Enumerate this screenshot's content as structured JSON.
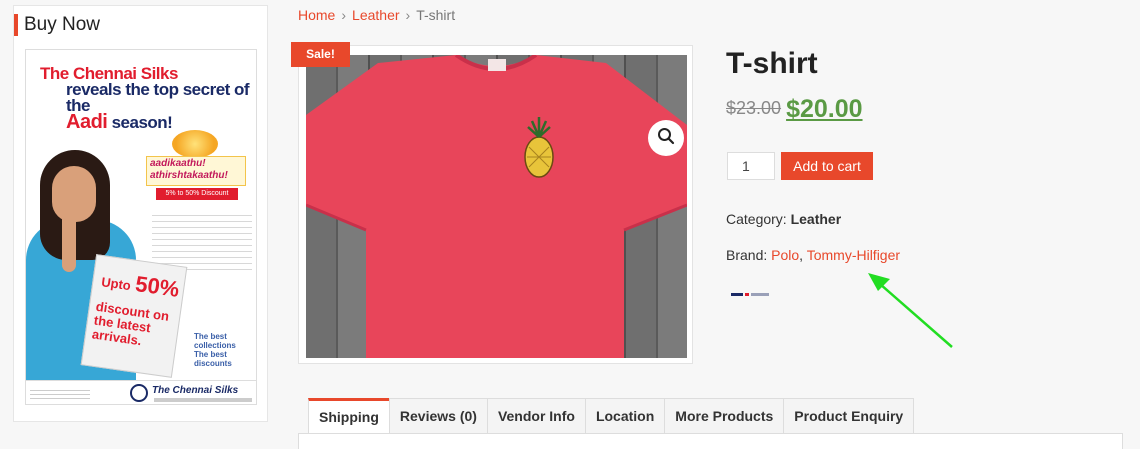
{
  "sidebar": {
    "title": "Buy Now",
    "ad": {
      "headline_1": "The Chennai Silks",
      "headline_2": "reveals the top secret of the",
      "headline_3a": "Aadi",
      "headline_3b": "season!",
      "seal_line_1": "aadikaathu!",
      "seal_line_2": "athirshtakaathu!",
      "seal_band": "5% to 50% Discount",
      "bag_upto": "Upto",
      "bag_percent": "50%",
      "bag_text": "discount on the latest arrivals.",
      "tagline": "The best collections The best discounts",
      "footer_brand": "The Chennai Silks"
    }
  },
  "breadcrumb": {
    "home": "Home",
    "category": "Leather",
    "current": "T-shirt",
    "separator": "›"
  },
  "product": {
    "sale_badge": "Sale!",
    "title": "T-shirt",
    "old_price": "$23.00",
    "new_price": "$20.00",
    "quantity": "1",
    "add_to_cart": "Add to cart",
    "category_label": "Category:",
    "category_value": "Leather",
    "brand_label": "Brand:",
    "brand_1": "Polo",
    "brand_sep": ",",
    "brand_2": "Tommy-Hilfiger"
  },
  "tabs": [
    {
      "label": "Shipping",
      "active": true
    },
    {
      "label": "Reviews (0)",
      "active": false
    },
    {
      "label": "Vendor Info",
      "active": false
    },
    {
      "label": "Location",
      "active": false
    },
    {
      "label": "More Products",
      "active": false
    },
    {
      "label": "Product Enquiry",
      "active": false
    }
  ],
  "colors": {
    "accent": "#e8482b",
    "price_green": "#5a9a44",
    "shirt": "#e8455a",
    "arrow": "#22dd22"
  }
}
